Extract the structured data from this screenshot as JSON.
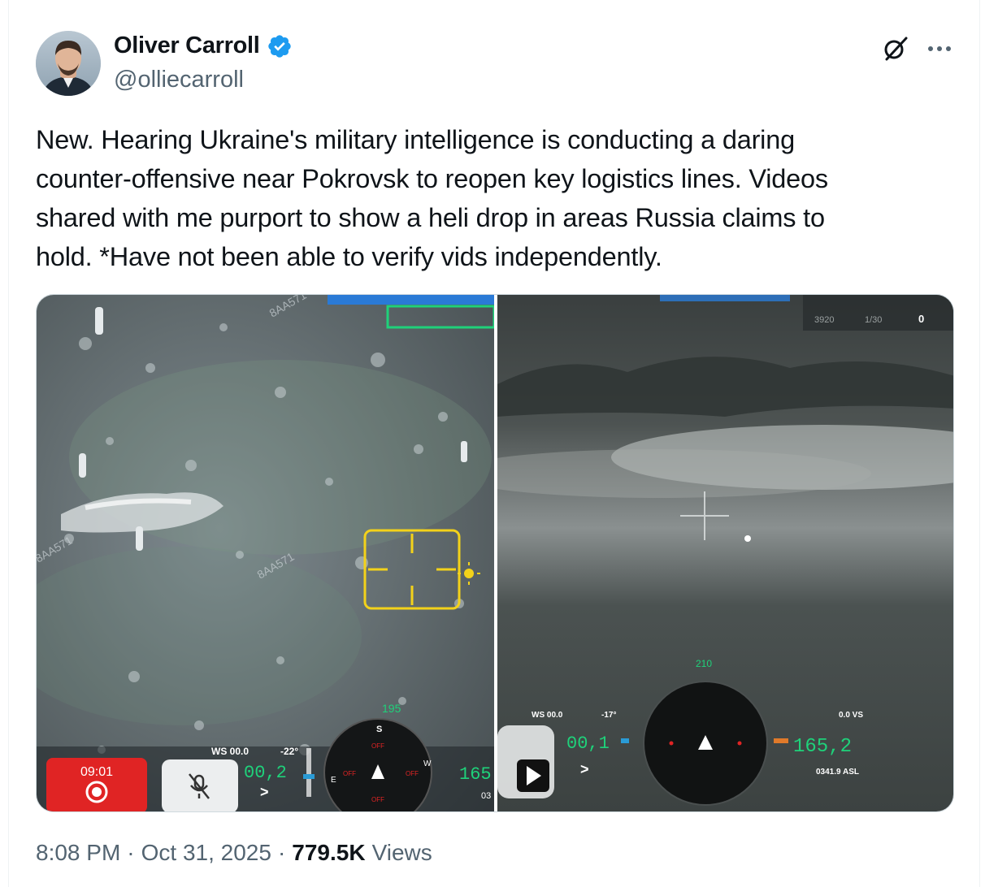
{
  "author": {
    "display_name": "Oliver Carroll",
    "handle": "@olliecarroll",
    "verified": true,
    "verified_color": "#1d9bf0"
  },
  "icons": {
    "verified": "verified-badge-icon",
    "grok": "grok-icon",
    "more": "more-options-icon",
    "play": "play-icon",
    "record": "record-icon",
    "mic_off": "microphone-off-icon",
    "crosshair": "crosshair-icon",
    "sun": "sun-icon"
  },
  "tweet": {
    "lines": [
      "New. Hearing Ukraine's military intelligence is conducting a daring",
      "counter-offensive near Pokrovsk to reopen key logistics lines. Videos",
      "shared with me purport to show a heli drop in areas Russia claims to",
      "hold. *Have not been able to verify vids independently."
    ]
  },
  "media": {
    "left": {
      "watermark_1": "8AA571",
      "watermark_2": "8AA571",
      "watermark_3": "8AA571",
      "rec_timer": "09:01",
      "ws": "WS 00.0",
      "temp": "-22°",
      "speed": "00,2",
      "heading": "195",
      "alt": "165",
      "alt_sub": "03",
      "compass_s": "S",
      "compass_e": "E",
      "compass_w": "W",
      "compass_off": "OFF",
      "nav_arrow": ">"
    },
    "right": {
      "top_a": "3920",
      "top_b": "1/30",
      "top_c": "0",
      "heading": "210",
      "ws": "WS 00.0",
      "temp": "-17°",
      "speed": "00,1",
      "vs": "0.0  VS",
      "alt": "165,2",
      "asl": "0341.9 ASL",
      "nav_arrow": ">"
    }
  },
  "footer": {
    "time": "8:08 PM",
    "separator": "·",
    "date": "Oct 31, 2025",
    "views_count": "779.5K",
    "views_label": "Views"
  },
  "colors": {
    "text_primary": "#0f1419",
    "text_secondary": "#536471",
    "hud_green": "#1fd17a",
    "hud_yellow": "#f3d21a",
    "rec_red": "#e02424"
  }
}
